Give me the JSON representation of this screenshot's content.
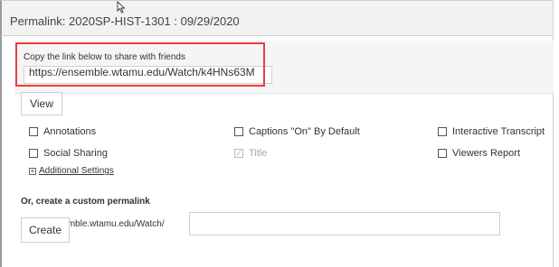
{
  "header": {
    "title": "Permalink: 2020SP-HIST-1301 : 09/29/2020",
    "cursor_icon": "pointer-cursor-icon"
  },
  "copy_section": {
    "label": "Copy the link below to share with friends",
    "link": "https://ensemble.wtamu.edu/Watch/k4HNs63M",
    "highlight_color": "#e8403f"
  },
  "buttons": {
    "view": "View",
    "create": "Create"
  },
  "options": [
    {
      "label": "Annotations",
      "checked": false,
      "disabled": false
    },
    {
      "label": "Captions \"On\" By Default",
      "checked": false,
      "disabled": false
    },
    {
      "label": "Interactive Transcript",
      "checked": false,
      "disabled": false
    },
    {
      "label": "Social Sharing",
      "checked": false,
      "disabled": false
    },
    {
      "label": "Title",
      "checked": true,
      "disabled": true
    },
    {
      "label": "Viewers Report",
      "checked": false,
      "disabled": false
    }
  ],
  "additional_settings": {
    "icon": "plus-box-icon",
    "label": "Additional Settings"
  },
  "custom_permalink": {
    "label": "Or, create a custom permalink",
    "prefix": "https://ensemble.wtamu.edu/Watch/",
    "value": ""
  }
}
